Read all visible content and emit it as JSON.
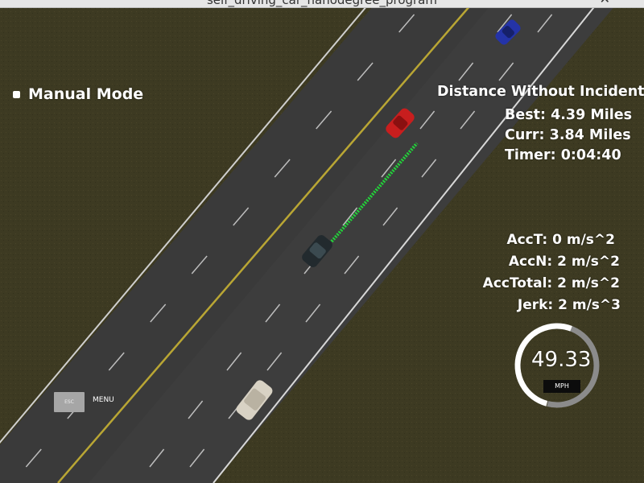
{
  "window": {
    "title": "self_driving_car_nanodegree_program",
    "close_glyph": "✕"
  },
  "mode": {
    "label": "Manual Mode"
  },
  "distance": {
    "title": "Distance Without Incident",
    "best": "Best: 4.39 Miles",
    "curr": "Curr: 3.84 Miles",
    "timer": "Timer: 0:04:40"
  },
  "acceleration": {
    "acc_t": "AccT: 0 m/s^2",
    "acc_n": "AccN: 2 m/s^2",
    "acc_total": "AccTotal: 2 m/s^2",
    "jerk": "Jerk: 2 m/s^3"
  },
  "speedometer": {
    "value": "49.33",
    "unit": "MPH",
    "fill_fraction": 0.62
  },
  "controls": {
    "esc_label": "ESC",
    "menu_label": "MENU"
  },
  "colors": {
    "grass": "#3d3a22",
    "road": "#3b3b3b",
    "center_line": "#b9a634",
    "path": "#22d43a",
    "ego_car": "#222a2e",
    "red_car": "#c81e1e",
    "blue_car": "#2433a8",
    "white_car": "#d8d2c4"
  }
}
